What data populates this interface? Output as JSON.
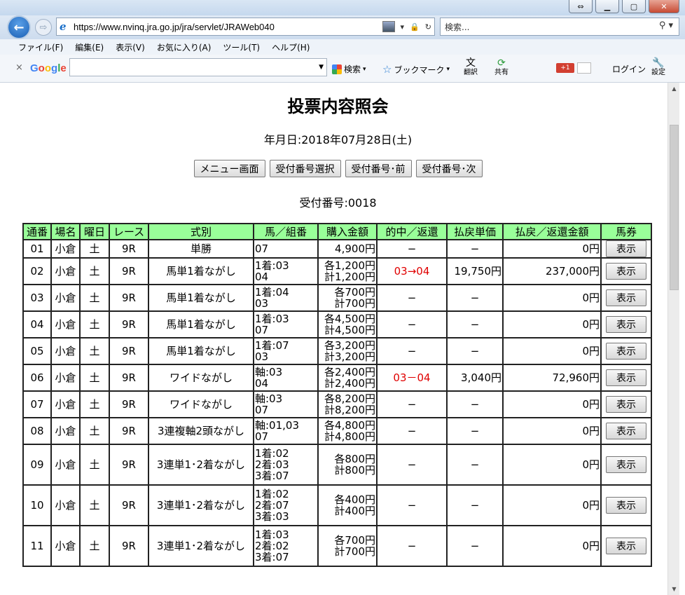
{
  "browser": {
    "url": "https://www.nvinq.jra.go.jp/jra/servlet/JRAWeb040",
    "search_placeholder": "検索...",
    "menu": [
      "ファイル(F)",
      "編集(E)",
      "表示(V)",
      "お気に入り(A)",
      "ツール(T)",
      "ヘルプ(H)"
    ],
    "google_bar": {
      "logo": "Google",
      "search_label": "検索",
      "bookmark_label": "ブックマーク",
      "translate_label": "翻訳",
      "share_label": "共有",
      "gplus_label": "+1",
      "login_label": "ログイン",
      "settings_label": "設定"
    }
  },
  "page": {
    "title": "投票内容照会",
    "date_line": "年月日:2018年07月28日(土)",
    "buttons": {
      "menu": "メニュー画面",
      "select": "受付番号選択",
      "prev": "受付番号･前",
      "next": "受付番号･次"
    },
    "receipt_line": "受付番号:0018"
  },
  "table": {
    "headers": [
      "通番",
      "場名",
      "曜日",
      "レース",
      "式別",
      "馬／組番",
      "購入金額",
      "的中／返還",
      "払戻単価",
      "払戻／返還金額",
      "馬券"
    ],
    "show_label": "表示",
    "rows": [
      {
        "no": "01",
        "venue": "小倉",
        "day": "土",
        "race": "9R",
        "type": "単勝",
        "horses": [
          "07"
        ],
        "amount": [
          "4,900円"
        ],
        "hit": "−",
        "hit_red": false,
        "unit": "−",
        "payout": "0円"
      },
      {
        "no": "02",
        "venue": "小倉",
        "day": "土",
        "race": "9R",
        "type": "馬単1着ながし",
        "horses": [
          "1着:03",
          "04"
        ],
        "amount": [
          "各1,200円",
          "計1,200円"
        ],
        "hit": "03→04",
        "hit_red": true,
        "unit": "19,750円",
        "payout": "237,000円"
      },
      {
        "no": "03",
        "venue": "小倉",
        "day": "土",
        "race": "9R",
        "type": "馬単1着ながし",
        "horses": [
          "1着:04",
          "03"
        ],
        "amount": [
          "各700円",
          "計700円"
        ],
        "hit": "−",
        "hit_red": false,
        "unit": "−",
        "payout": "0円"
      },
      {
        "no": "04",
        "venue": "小倉",
        "day": "土",
        "race": "9R",
        "type": "馬単1着ながし",
        "horses": [
          "1着:03",
          "07"
        ],
        "amount": [
          "各4,500円",
          "計4,500円"
        ],
        "hit": "−",
        "hit_red": false,
        "unit": "−",
        "payout": "0円"
      },
      {
        "no": "05",
        "venue": "小倉",
        "day": "土",
        "race": "9R",
        "type": "馬単1着ながし",
        "horses": [
          "1着:07",
          "03"
        ],
        "amount": [
          "各3,200円",
          "計3,200円"
        ],
        "hit": "−",
        "hit_red": false,
        "unit": "−",
        "payout": "0円"
      },
      {
        "no": "06",
        "venue": "小倉",
        "day": "土",
        "race": "9R",
        "type": "ワイドながし",
        "horses": [
          "軸:03",
          "04"
        ],
        "amount": [
          "各2,400円",
          "計2,400円"
        ],
        "hit": "03－04",
        "hit_red": true,
        "unit": "3,040円",
        "payout": "72,960円"
      },
      {
        "no": "07",
        "venue": "小倉",
        "day": "土",
        "race": "9R",
        "type": "ワイドながし",
        "horses": [
          "軸:03",
          "07"
        ],
        "amount": [
          "各8,200円",
          "計8,200円"
        ],
        "hit": "−",
        "hit_red": false,
        "unit": "−",
        "payout": "0円"
      },
      {
        "no": "08",
        "venue": "小倉",
        "day": "土",
        "race": "9R",
        "type": "3連複軸2頭ながし",
        "horses": [
          "軸:01,03",
          "07"
        ],
        "amount": [
          "各4,800円",
          "計4,800円"
        ],
        "hit": "−",
        "hit_red": false,
        "unit": "−",
        "payout": "0円"
      },
      {
        "no": "09",
        "venue": "小倉",
        "day": "土",
        "race": "9R",
        "type": "3連単1･2着ながし",
        "horses": [
          "1着:02",
          "2着:03",
          "3着:07"
        ],
        "amount": [
          "各800円",
          "計800円"
        ],
        "hit": "−",
        "hit_red": false,
        "unit": "−",
        "payout": "0円"
      },
      {
        "no": "10",
        "venue": "小倉",
        "day": "土",
        "race": "9R",
        "type": "3連単1･2着ながし",
        "horses": [
          "1着:02",
          "2着:07",
          "3着:03"
        ],
        "amount": [
          "各400円",
          "計400円"
        ],
        "hit": "−",
        "hit_red": false,
        "unit": "−",
        "payout": "0円"
      },
      {
        "no": "11",
        "venue": "小倉",
        "day": "土",
        "race": "9R",
        "type": "3連単1･2着ながし",
        "horses": [
          "1着:03",
          "2着:02",
          "3着:07"
        ],
        "amount": [
          "各700円",
          "計700円"
        ],
        "hit": "−",
        "hit_red": false,
        "unit": "−",
        "payout": "0円"
      }
    ]
  }
}
